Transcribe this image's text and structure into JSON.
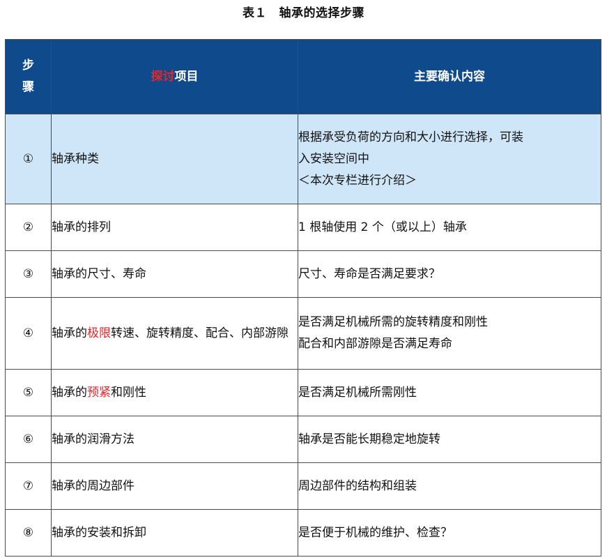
{
  "caption": "表１　轴承的选择步骤",
  "header": {
    "step": [
      "步",
      "骤"
    ],
    "item_red": "探讨",
    "item_rest": "项目",
    "content": "主要确认内容"
  },
  "rows": [
    {
      "num": "①",
      "item": [
        {
          "text": "轴承种类",
          "red": false
        }
      ],
      "content": [
        "根据承受负荷的方向和大小进行选择，可装",
        "入安装空间中",
        "＜本次专栏进行介绍＞"
      ],
      "highlight": true
    },
    {
      "num": "②",
      "item": [
        {
          "text": "轴承的排列",
          "red": false
        }
      ],
      "content": [
        "1 根轴使用 2 个（或以上）轴承"
      ],
      "highlight": false
    },
    {
      "num": "③",
      "item": [
        {
          "text": "轴承的尺寸、寿命",
          "red": false
        }
      ],
      "content": [
        "尺寸、寿命是否满足要求？"
      ],
      "highlight": false
    },
    {
      "num": "④",
      "item": [
        {
          "text": "轴承的",
          "red": false
        },
        {
          "text": "极限",
          "red": true
        },
        {
          "text": "转速、旋转精度、配合、内部游隙",
          "red": false
        }
      ],
      "content": [
        "是否满足机械所需的旋转精度和刚性",
        "配合和内部游隙是否满足寿命"
      ],
      "highlight": false
    },
    {
      "num": "⑤",
      "item": [
        {
          "text": "轴承的",
          "red": false
        },
        {
          "text": "预紧",
          "red": true
        },
        {
          "text": "和刚性",
          "red": false
        }
      ],
      "content": [
        "是否满足机械所需刚性"
      ],
      "highlight": false
    },
    {
      "num": "⑥",
      "item": [
        {
          "text": "轴承的润滑方法",
          "red": false
        }
      ],
      "content": [
        "轴承是否能长期稳定地旋转"
      ],
      "highlight": false
    },
    {
      "num": "⑦",
      "item": [
        {
          "text": "轴承的周边部件",
          "red": false
        }
      ],
      "content": [
        "周边部件的结构和组装"
      ],
      "highlight": false
    },
    {
      "num": "⑧",
      "item": [
        {
          "text": "轴承的安装和拆卸",
          "red": false
        }
      ],
      "content": [
        "是否便于机械的维护、检查？"
      ],
      "highlight": false
    }
  ],
  "colors": {
    "header_bg": "#0f4a8c",
    "highlight_bg": "#cfe6f8",
    "accent_red": "#e8262a"
  }
}
